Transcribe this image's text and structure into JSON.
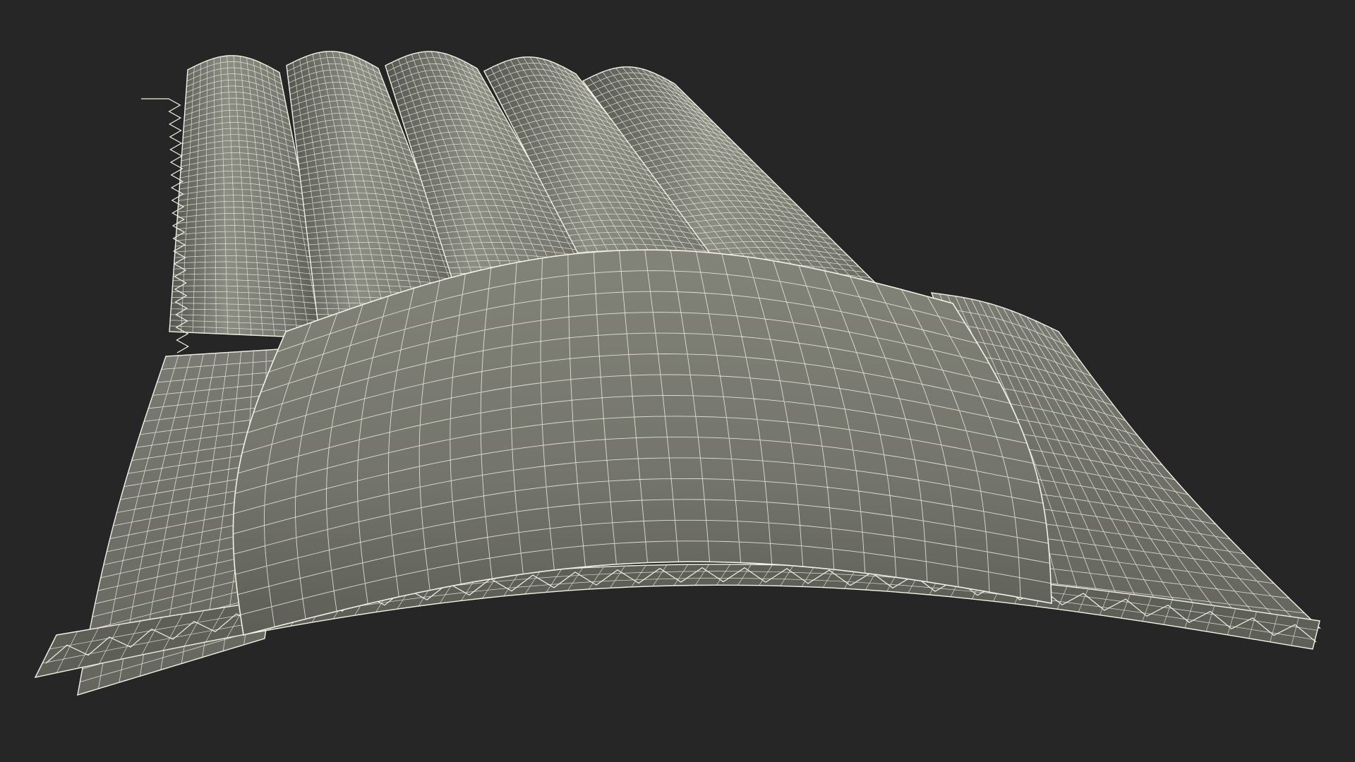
{
  "scene": {
    "subject": "wireframe-render",
    "colors": {
      "background": "#262626",
      "surface": "#74756c",
      "surface_dark": "#5e5f57",
      "surface_light": "#8a8b81",
      "wire": "#f1f1e4"
    },
    "tube_count": 5
  }
}
